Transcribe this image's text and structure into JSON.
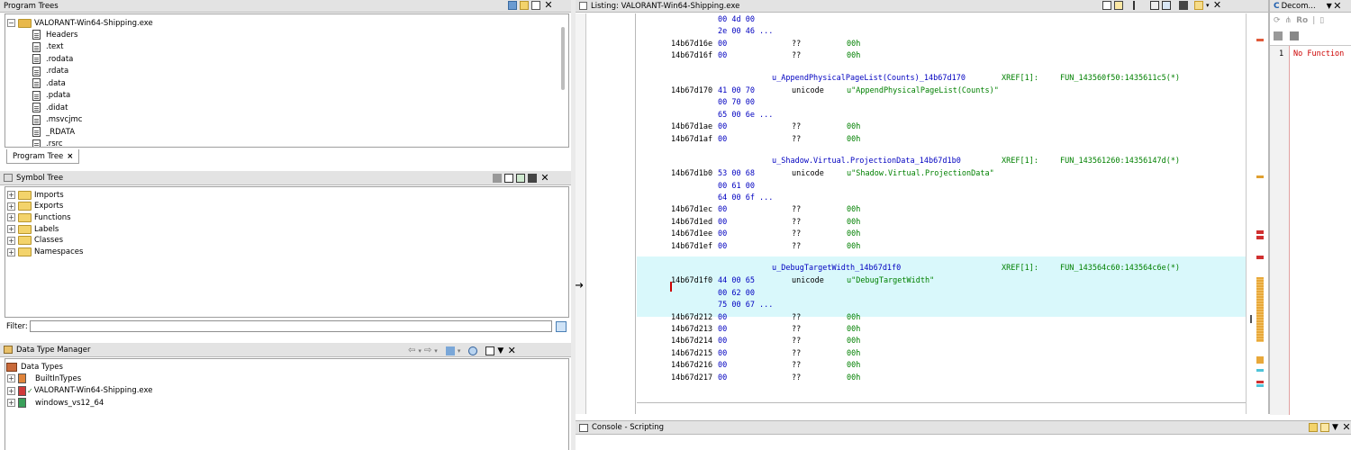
{
  "program_trees": {
    "title": "Program Trees",
    "root": "VALORANT-Win64-Shipping.exe",
    "sections": [
      "Headers",
      ".text",
      ".rodata",
      ".rdata",
      ".data",
      ".pdata",
      ".didat",
      ".msvcjmc",
      "_RDATA",
      ".rsrc"
    ],
    "tab_label": "Program Tree",
    "tab_close": "×"
  },
  "symbol_tree": {
    "title": "Symbol Tree",
    "items": [
      "Imports",
      "Exports",
      "Functions",
      "Labels",
      "Classes",
      "Namespaces"
    ],
    "filter_label": "Filter:",
    "filter_value": ""
  },
  "data_type_manager": {
    "title": "Data Type Manager",
    "root": "Data Types",
    "items": [
      "BuiltInTypes",
      "VALORANT-Win64-Shipping.exe",
      "windows_vs12_64"
    ]
  },
  "listing": {
    "title": "Listing:  VALORANT-Win64-Shipping.exe",
    "arrow": "→",
    "rows": [
      {
        "addr": "",
        "bytes": "00 4d 00",
        "mnem": "",
        "op": ""
      },
      {
        "addr": "",
        "bytes": "2e 00 46 ...",
        "mnem": "",
        "op": ""
      },
      {
        "addr": "14b67d16e",
        "bytes": "00",
        "mnem": "??",
        "op": "00h"
      },
      {
        "addr": "14b67d16f",
        "bytes": "00",
        "mnem": "??",
        "op": "00h"
      },
      {
        "label": "u_AppendPhysicalPageList(Counts)_14b67d170",
        "xref": "XREF[1]:",
        "fun": "FUN_143560f50:1435611c5(*)"
      },
      {
        "addr": "14b67d170",
        "bytes": "41 00 70",
        "mnem": "unicode",
        "op": "u\"AppendPhysicalPageList(Counts)\""
      },
      {
        "addr": "",
        "bytes": "00 70 00",
        "mnem": "",
        "op": ""
      },
      {
        "addr": "",
        "bytes": "65 00 6e ...",
        "mnem": "",
        "op": ""
      },
      {
        "addr": "14b67d1ae",
        "bytes": "00",
        "mnem": "??",
        "op": "00h"
      },
      {
        "addr": "14b67d1af",
        "bytes": "00",
        "mnem": "??",
        "op": "00h"
      },
      {
        "label": "u_Shadow.Virtual.ProjectionData_14b67d1b0",
        "xref": "XREF[1]:",
        "fun": "FUN_143561260:14356147d(*)"
      },
      {
        "addr": "14b67d1b0",
        "bytes": "53 00 68",
        "mnem": "unicode",
        "op": "u\"Shadow.Virtual.ProjectionData\""
      },
      {
        "addr": "",
        "bytes": "00 61 00",
        "mnem": "",
        "op": ""
      },
      {
        "addr": "",
        "bytes": "64 00 6f ...",
        "mnem": "",
        "op": ""
      },
      {
        "addr": "14b67d1ec",
        "bytes": "00",
        "mnem": "??",
        "op": "00h"
      },
      {
        "addr": "14b67d1ed",
        "bytes": "00",
        "mnem": "??",
        "op": "00h"
      },
      {
        "addr": "14b67d1ee",
        "bytes": "00",
        "mnem": "??",
        "op": "00h"
      },
      {
        "addr": "14b67d1ef",
        "bytes": "00",
        "mnem": "??",
        "op": "00h"
      },
      {
        "label": "u_DebugTargetWidth_14b67d1f0",
        "xref": "XREF[1]:",
        "fun": "FUN_143564c60:143564c6e(*)"
      },
      {
        "addr": "14b67d1f0",
        "bytes": "44 00 65",
        "mnem": "unicode",
        "op": "u\"DebugTargetWidth\""
      },
      {
        "addr": "",
        "bytes": "00 62 00",
        "mnem": "",
        "op": ""
      },
      {
        "addr": "",
        "bytes": "75 00 67 ...",
        "mnem": "",
        "op": ""
      },
      {
        "addr": "14b67d212",
        "bytes": "00",
        "mnem": "??",
        "op": "00h"
      },
      {
        "addr": "14b67d213",
        "bytes": "00",
        "mnem": "??",
        "op": "00h"
      },
      {
        "addr": "14b67d214",
        "bytes": "00",
        "mnem": "??",
        "op": "00h"
      },
      {
        "addr": "14b67d215",
        "bytes": "00",
        "mnem": "??",
        "op": "00h"
      },
      {
        "addr": "14b67d216",
        "bytes": "00",
        "mnem": "??",
        "op": "00h"
      },
      {
        "addr": "14b67d217",
        "bytes": "00",
        "mnem": "??",
        "op": "00h"
      }
    ]
  },
  "decompiler": {
    "title": "Decom...",
    "line_no": "1",
    "text": "No Function",
    "ro_label": "Ro"
  },
  "console": {
    "title": "Console - Scripting"
  },
  "colors": {
    "header_bg": "#e3e3e3",
    "highlight": "#d9f8fb",
    "address_blue": "#0000c0",
    "operand_green": "#008000",
    "error_red": "#cc0000"
  }
}
